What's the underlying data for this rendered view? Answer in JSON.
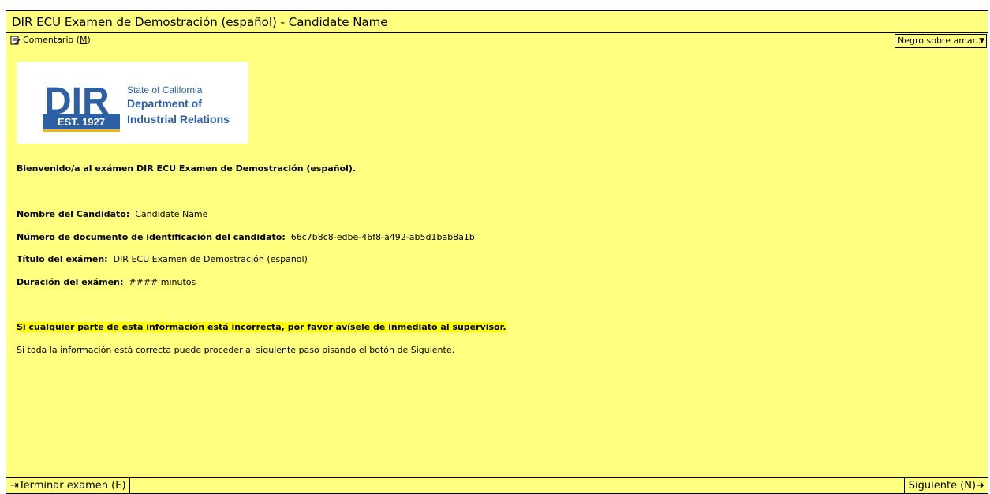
{
  "window": {
    "title": "DIR ECU Examen de Demostración (español) - Candidate Name"
  },
  "toolbar": {
    "comment_label": "Comentario (",
    "comment_key": "M",
    "comment_close": ")",
    "theme_selected": "Negro sobre amar..."
  },
  "logo": {
    "mark": "DIR",
    "established": "EST. 1927",
    "state": "State of California",
    "dept_line1": "Department of",
    "dept_line2": "Industrial Relations"
  },
  "welcome": "Bienvenido/a al exámen DIR ECU Examen de Demostración (español).",
  "fields": [
    {
      "label": "Nombre del Candidato:",
      "value": "Candidate Name"
    },
    {
      "label": "Número de documento de identificación del candidato:",
      "value": "66c7b8c8-edbe-46f8-a492-ab5d1bab8a1b"
    },
    {
      "label": "Título del exámen:",
      "value": "DIR ECU Examen de Demostración (español)"
    },
    {
      "label": "Duración del exámen:",
      "value": "#### minutos"
    }
  ],
  "warning": "Si cualquier parte de esta información está incorrecta, por favor avísele de inmediato al supervisor.",
  "instruction": "Si toda la información está correcta puede proceder al siguiente paso pisando el botón de Siguiente.",
  "footer": {
    "end_label": "Terminar examen (E)",
    "next_label": "Siguiente (N)"
  },
  "colors": {
    "background": "#ffff80",
    "highlight": "#ffff00",
    "dir_blue": "#2d5fa3",
    "dir_gold": "#f0b323"
  }
}
